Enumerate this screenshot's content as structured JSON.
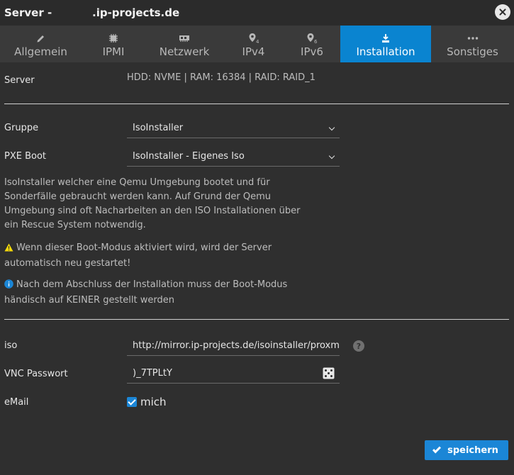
{
  "window": {
    "title_prefix": "Server -",
    "title_host": ".ip-projects.de"
  },
  "tabs": [
    {
      "label": "Allgemein",
      "icon": "pencil-icon"
    },
    {
      "label": "IPMI",
      "icon": "chip-icon"
    },
    {
      "label": "Netzwerk",
      "icon": "network-card-icon"
    },
    {
      "label": "IPv4",
      "icon": "pin-4-icon"
    },
    {
      "label": "IPv6",
      "icon": "pin-6-icon"
    },
    {
      "label": "Installation",
      "icon": "download-icon",
      "active": true
    },
    {
      "label": "Sonstiges",
      "icon": "ellipsis-icon"
    }
  ],
  "server": {
    "label": "Server",
    "value": "HDD: NVME | RAM: 16384 | RAID: RAID_1"
  },
  "gruppe": {
    "label": "Gruppe",
    "selected": "IsoInstaller"
  },
  "pxe": {
    "label": "PXE Boot",
    "selected": "IsoInstaller - Eigenes Iso"
  },
  "description": "IsoInstaller welcher eine Qemu Umgebung bootet und für Sonderfälle gebraucht werden kann. Auf Grund der Qemu Umgebung sind oft Nacharbeiten an den ISO Installationen über ein Rescue System notwendig.",
  "warning": "Wenn dieser Boot-Modus aktiviert wird, wird der Server automatisch neu gestartet!",
  "info": "Nach dem Abschluss der Installation muss der Boot-Modus händisch auf KEINER gestellt werden",
  "iso": {
    "label": "iso",
    "value": "http://mirror.ip-projects.de/isoinstaller/proxm",
    "help": "?"
  },
  "vnc": {
    "label": "VNC Passwort",
    "value": ")_7TPLtY"
  },
  "email": {
    "label": "eMail",
    "checkbox_label": "mich",
    "checked": true
  },
  "save_label": "speichern",
  "colors": {
    "accent": "#0a84d0",
    "button": "#1b86d6",
    "warning": "#f5d90a",
    "info": "#1b86d6"
  }
}
